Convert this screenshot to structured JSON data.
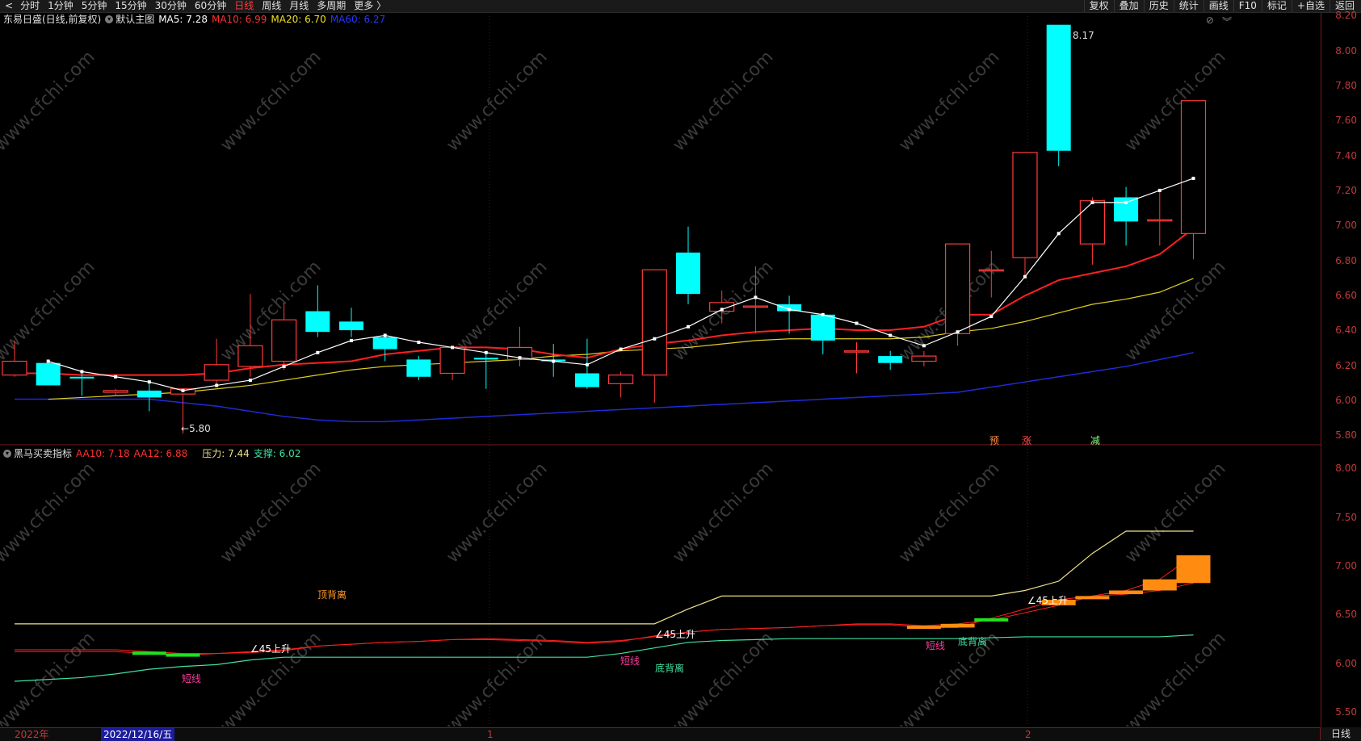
{
  "toolbar": {
    "back_icon": "<",
    "periods": [
      "分时",
      "1分钟",
      "5分钟",
      "15分钟",
      "30分钟",
      "60分钟",
      "日线",
      "周线",
      "月线",
      "多周期",
      "更多 〉"
    ],
    "active_period": "日线",
    "right_items": [
      "复权",
      "叠加",
      "历史",
      "统计",
      "画线",
      "F10",
      "标记",
      "+自选",
      "返回"
    ]
  },
  "main_legend": {
    "stock": "东易日盛(日线,前复权)",
    "chart_name": "默认主图",
    "ma5": "MA5: 7.28",
    "ma10": "MA10: 6.99",
    "ma20": "MA20: 6.70",
    "ma60": "MA60: 6.27"
  },
  "sub_legend": {
    "name": "黑马买卖指标",
    "aa10": "AA10: 7.18",
    "aa12": "AA12: 6.88",
    "pressure": "压力: 7.44",
    "support": "支撑: 6.02"
  },
  "main_axis": [
    "8.20",
    "8.00",
    "7.80",
    "7.60",
    "7.40",
    "7.20",
    "7.00",
    "6.80",
    "6.60",
    "6.40",
    "6.20",
    "6.00",
    "5.80"
  ],
  "sub_axis": [
    "8.00",
    "7.50",
    "7.00",
    "6.50",
    "6.00",
    "5.50"
  ],
  "annotations": {
    "high": "8.17",
    "low": "5.80",
    "flags": [
      "预",
      "涨",
      "减"
    ],
    "sub_labels": {
      "top_divergence": "顶背离",
      "bottom_divergence": "底背离",
      "short_line": "短线",
      "rise45": "∠45上升"
    }
  },
  "bottom_axis": {
    "year": "2022年",
    "cursor_date": "2022/12/16/五",
    "month1": "1",
    "month2": "2",
    "period": "日线"
  },
  "watermark": "www.cfchi.com",
  "colors": {
    "up": "#ff3b3b",
    "down": "#00ffff",
    "ma5": "#ffffff",
    "ma10": "#ff2020",
    "ma20": "#e0d020",
    "ma60": "#1f2bd8",
    "axis": "#c03a3a"
  },
  "chart_data": {
    "type": "candlestick",
    "price_range": [
      5.75,
      8.22
    ],
    "candles": [
      {
        "o": 6.14,
        "h": 6.34,
        "l": 6.13,
        "c": 6.22
      },
      {
        "o": 6.21,
        "h": 6.23,
        "l": 6.08,
        "c": 6.08
      },
      {
        "o": 6.13,
        "h": 6.16,
        "l": 6.02,
        "c": 6.12
      },
      {
        "o": 6.04,
        "h": 6.06,
        "l": 6.02,
        "c": 6.05
      },
      {
        "o": 6.05,
        "h": 6.09,
        "l": 5.93,
        "c": 6.01
      },
      {
        "o": 6.03,
        "h": 6.06,
        "l": 5.8,
        "c": 6.06
      },
      {
        "o": 6.11,
        "h": 6.35,
        "l": 6.07,
        "c": 6.2
      },
      {
        "o": 6.19,
        "h": 6.61,
        "l": 6.13,
        "c": 6.31
      },
      {
        "o": 6.22,
        "h": 6.56,
        "l": 6.17,
        "c": 6.46
      },
      {
        "o": 6.51,
        "h": 6.66,
        "l": 6.36,
        "c": 6.39
      },
      {
        "o": 6.45,
        "h": 6.53,
        "l": 6.36,
        "c": 6.4
      },
      {
        "o": 6.36,
        "h": 6.37,
        "l": 6.22,
        "c": 6.29
      },
      {
        "o": 6.23,
        "h": 6.25,
        "l": 6.11,
        "c": 6.13
      },
      {
        "o": 6.15,
        "h": 6.3,
        "l": 6.11,
        "c": 6.3
      },
      {
        "o": 6.24,
        "h": 6.26,
        "l": 6.06,
        "c": 6.23
      },
      {
        "o": 6.23,
        "h": 6.42,
        "l": 6.19,
        "c": 6.3
      },
      {
        "o": 6.23,
        "h": 6.32,
        "l": 6.13,
        "c": 6.22
      },
      {
        "o": 6.15,
        "h": 6.35,
        "l": 6.06,
        "c": 6.07
      },
      {
        "o": 6.09,
        "h": 6.16,
        "l": 6.01,
        "c": 6.14
      },
      {
        "o": 6.14,
        "h": 6.74,
        "l": 5.98,
        "c": 6.75
      },
      {
        "o": 6.85,
        "h": 7.0,
        "l": 6.55,
        "c": 6.61
      },
      {
        "o": 6.51,
        "h": 6.63,
        "l": 6.44,
        "c": 6.56
      },
      {
        "o": 6.54,
        "h": 6.77,
        "l": 6.38,
        "c": 6.54
      },
      {
        "o": 6.55,
        "h": 6.6,
        "l": 6.38,
        "c": 6.51
      },
      {
        "o": 6.49,
        "h": 6.49,
        "l": 6.26,
        "c": 6.34
      },
      {
        "o": 6.28,
        "h": 6.33,
        "l": 6.15,
        "c": 6.28
      },
      {
        "o": 6.25,
        "h": 6.28,
        "l": 6.17,
        "c": 6.21
      },
      {
        "o": 6.22,
        "h": 6.28,
        "l": 6.19,
        "c": 6.25
      },
      {
        "o": 6.38,
        "h": 6.9,
        "l": 6.31,
        "c": 6.9
      },
      {
        "o": 6.75,
        "h": 6.86,
        "l": 6.59,
        "c": 6.75
      },
      {
        "o": 6.82,
        "h": 7.23,
        "l": 6.72,
        "c": 7.43
      },
      {
        "o": 8.17,
        "h": 8.17,
        "l": 7.35,
        "c": 7.44
      },
      {
        "o": 6.9,
        "h": 7.17,
        "l": 6.78,
        "c": 7.15
      },
      {
        "o": 7.17,
        "h": 7.23,
        "l": 6.89,
        "c": 7.03
      },
      {
        "o": 7.04,
        "h": 7.2,
        "l": 6.89,
        "c": 7.04
      },
      {
        "o": 6.96,
        "h": 7.73,
        "l": 6.81,
        "c": 7.73
      }
    ],
    "ma5": [
      6.22,
      6.16,
      6.13,
      6.1,
      6.05,
      6.08,
      6.11,
      6.19,
      6.27,
      6.34,
      6.37,
      6.33,
      6.3,
      6.27,
      6.24,
      6.22,
      6.2,
      6.29,
      6.35,
      6.42,
      6.52,
      6.59,
      6.52,
      6.49,
      6.44,
      6.37,
      6.31,
      6.39,
      6.48,
      6.71,
      6.96,
      7.14,
      7.14,
      7.21,
      7.28
    ],
    "ma10": [
      6.15,
      6.15,
      6.14,
      6.14,
      6.14,
      6.14,
      6.15,
      6.18,
      6.2,
      6.21,
      6.22,
      6.26,
      6.28,
      6.3,
      6.3,
      6.29,
      6.26,
      6.24,
      6.29,
      6.32,
      6.34,
      6.37,
      6.39,
      6.4,
      6.41,
      6.4,
      6.4,
      6.42,
      6.49,
      6.49,
      6.6,
      6.69,
      6.73,
      6.77,
      6.84,
      6.99
    ],
    "ma20": [
      6.0,
      6.01,
      6.02,
      6.03,
      6.04,
      6.06,
      6.08,
      6.11,
      6.14,
      6.17,
      6.19,
      6.2,
      6.21,
      6.22,
      6.23,
      6.25,
      6.26,
      6.28,
      6.29,
      6.3,
      6.32,
      6.34,
      6.35,
      6.35,
      6.35,
      6.35,
      6.36,
      6.39,
      6.41,
      6.45,
      6.5,
      6.55,
      6.58,
      6.62,
      6.7
    ],
    "ma60": [
      6.0,
      6.0,
      6.0,
      6.0,
      6.0,
      5.98,
      5.96,
      5.93,
      5.9,
      5.88,
      5.87,
      5.87,
      5.88,
      5.89,
      5.9,
      5.91,
      5.92,
      5.93,
      5.94,
      5.95,
      5.96,
      5.97,
      5.98,
      5.99,
      6.0,
      6.01,
      6.02,
      6.03,
      6.04,
      6.07,
      6.1,
      6.13,
      6.16,
      6.19,
      6.23,
      6.27
    ],
    "sub_range": [
      5.35,
      8.25
    ],
    "pressure": [
      6.44,
      6.44,
      6.44,
      6.44,
      6.44,
      6.44,
      6.44,
      6.44,
      6.44,
      6.44,
      6.44,
      6.44,
      6.44,
      6.44,
      6.44,
      6.44,
      6.44,
      6.44,
      6.44,
      6.44,
      6.6,
      6.74,
      6.74,
      6.74,
      6.74,
      6.74,
      6.74,
      6.74,
      6.74,
      6.74,
      6.8,
      6.9,
      7.2,
      7.44,
      7.44,
      7.44
    ],
    "support": [
      5.82,
      5.84,
      5.86,
      5.9,
      5.95,
      5.98,
      6.0,
      6.05,
      6.08,
      6.08,
      6.08,
      6.08,
      6.08,
      6.08,
      6.08,
      6.08,
      6.08,
      6.08,
      6.12,
      6.18,
      6.24,
      6.26,
      6.27,
      6.28,
      6.28,
      6.28,
      6.28,
      6.28,
      6.28,
      6.29,
      6.3,
      6.3,
      6.3,
      6.3,
      6.3,
      6.32
    ],
    "aa12": [
      6.16,
      6.16,
      6.16,
      6.16,
      6.14,
      6.12,
      6.12,
      6.13,
      6.15,
      6.2,
      6.22,
      6.24,
      6.25,
      6.27,
      6.27,
      6.26,
      6.25,
      6.23,
      6.25,
      6.31,
      6.35,
      6.38,
      6.39,
      6.4,
      6.42,
      6.43,
      6.43,
      6.4,
      6.4,
      6.5,
      6.6,
      6.7,
      6.74,
      6.76,
      6.8,
      6.88
    ],
    "aa10": [
      6.14,
      6.14,
      6.14,
      6.14,
      6.12,
      6.1,
      6.12,
      6.14,
      6.16,
      6.2,
      6.22,
      6.24,
      6.25,
      6.27,
      6.28,
      6.27,
      6.26,
      6.24,
      6.26,
      6.3,
      6.35,
      6.38,
      6.39,
      6.4,
      6.42,
      6.44,
      6.44,
      6.42,
      6.44,
      6.48,
      6.56,
      6.64,
      6.74,
      6.8,
      6.92,
      7.18
    ]
  }
}
